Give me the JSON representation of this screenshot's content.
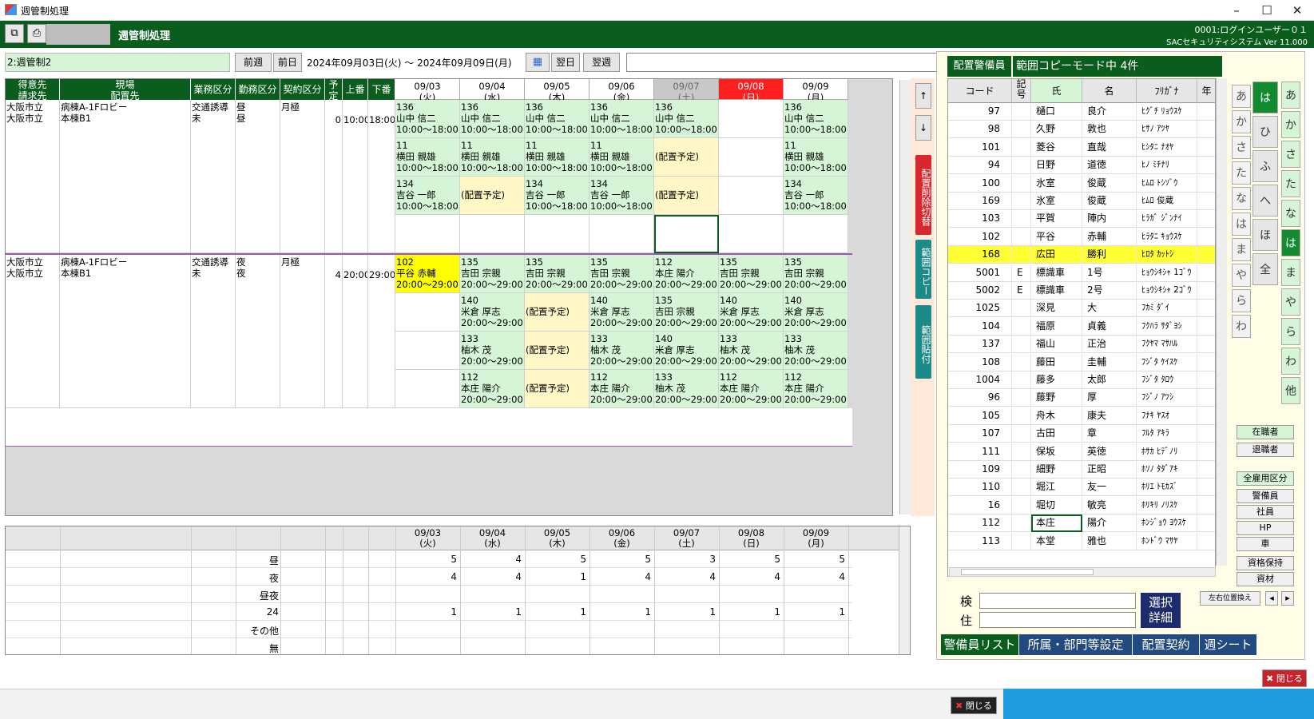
{
  "window": {
    "title": "週管制処理",
    "min": "–",
    "max": "☐",
    "close": "✕"
  },
  "app": {
    "name": "週管制処理",
    "user": "0001:ログインユーザー０１",
    "version": "SACセキュリティシステム Ver 11.000"
  },
  "toolbar": {
    "mode": "2:週管制2",
    "prev_week": "前週",
    "prev_day": "前日",
    "range": "2024年09月03日(火) ～ 2024年09月09日(月)",
    "next_day": "翌日",
    "next_week": "翌週"
  },
  "grid": {
    "headers": [
      "得意先\n請求先",
      "現場\n配置先",
      "業務区分",
      "勤務区分",
      "契約区分",
      "予\n定",
      "上番",
      "下番"
    ],
    "days": [
      {
        "d": "09/03",
        "w": "(火)"
      },
      {
        "d": "09/04",
        "w": "(水)"
      },
      {
        "d": "09/05",
        "w": "(木)"
      },
      {
        "d": "09/06",
        "w": "(金)"
      },
      {
        "d": "09/07",
        "w": "(土)"
      },
      {
        "d": "09/08",
        "w": "(日)"
      },
      {
        "d": "09/09",
        "w": "(月)"
      }
    ],
    "group1": {
      "cust1": "大阪市立",
      "cust2": "大阪市立",
      "site1": "病棟A-1Fロビー",
      "site2": "本棟B1",
      "work1": "交通誘導",
      "work2": "未",
      "shift1": "昼",
      "shift2": "昼",
      "contract": "月極",
      "plan": "0",
      "start": "10:00",
      "end": "18:00"
    },
    "group2": {
      "cust1": "大阪市立",
      "cust2": "大阪市立",
      "site1": "病棟A-1Fロビー",
      "site2": "本棟B1",
      "work1": "交通誘導",
      "work2": "未",
      "shift1": "夜",
      "shift2": "夜",
      "contract": "月極",
      "plan": "4",
      "start": "20:00",
      "end": "29:00"
    },
    "rows1": [
      [
        {
          "c": "g",
          "t": "136\n山中 信二\n10:00～18:00"
        },
        {
          "c": "g",
          "t": "136\n山中 信二\n10:00～18:00"
        },
        {
          "c": "g",
          "t": "136\n山中 信二\n10:00～18:00"
        },
        {
          "c": "g",
          "t": "136\n山中 信二\n10:00～18:00"
        },
        {
          "c": "g",
          "t": "136\n山中 信二\n10:00～18:00"
        },
        {
          "c": "w",
          "t": ""
        },
        {
          "c": "g",
          "t": "136\n山中 信二\n10:00～18:00"
        }
      ],
      [
        {
          "c": "g",
          "t": "11\n横田 親雄\n10:00～18:00"
        },
        {
          "c": "g",
          "t": "11\n横田 親雄\n10:00～18:00"
        },
        {
          "c": "g",
          "t": "11\n横田 親雄\n10:00～18:00"
        },
        {
          "c": "g",
          "t": "11\n横田 親雄\n10:00～18:00"
        },
        {
          "c": "y",
          "t": "\n(配置予定)"
        },
        {
          "c": "w",
          "t": ""
        },
        {
          "c": "g",
          "t": "11\n横田 親雄\n10:00～18:00"
        }
      ],
      [
        {
          "c": "g",
          "t": "134\n吉谷 一郎\n10:00～18:00"
        },
        {
          "c": "y",
          "t": "\n(配置予定)"
        },
        {
          "c": "g",
          "t": "134\n吉谷 一郎\n10:00～18:00"
        },
        {
          "c": "g",
          "t": "134\n吉谷 一郎\n10:00～18:00"
        },
        {
          "c": "y",
          "t": "\n(配置予定)"
        },
        {
          "c": "w",
          "t": ""
        },
        {
          "c": "g",
          "t": "134\n吉谷 一郎\n10:00～18:00"
        }
      ],
      [
        {
          "c": "w",
          "t": ""
        },
        {
          "c": "w",
          "t": ""
        },
        {
          "c": "w",
          "t": ""
        },
        {
          "c": "w",
          "t": ""
        },
        {
          "c": "w",
          "t": ""
        },
        {
          "c": "w",
          "t": ""
        },
        {
          "c": "w",
          "t": ""
        }
      ]
    ],
    "rows2": [
      [
        {
          "c": "yy",
          "t": "102\n平谷 赤輔\n20:00～29:00"
        },
        {
          "c": "g",
          "t": "135\n吉田 宗親\n20:00～29:00"
        },
        {
          "c": "g",
          "t": "135\n吉田 宗親\n20:00～29:00"
        },
        {
          "c": "g",
          "t": "135\n吉田 宗親\n20:00～29:00"
        },
        {
          "c": "g",
          "t": "112\n本庄 陽介\n20:00～29:00"
        },
        {
          "c": "g",
          "t": "135\n吉田 宗親\n20:00～29:00"
        },
        {
          "c": "g",
          "t": "135\n吉田 宗親\n20:00～29:00"
        }
      ],
      [
        {
          "c": "w",
          "t": ""
        },
        {
          "c": "g",
          "t": "140\n米倉 厚志\n20:00～29:00"
        },
        {
          "c": "y",
          "t": "\n(配置予定)"
        },
        {
          "c": "g",
          "t": "140\n米倉 厚志\n20:00～29:00"
        },
        {
          "c": "g",
          "t": "135\n吉田 宗親\n20:00～29:00"
        },
        {
          "c": "g",
          "t": "140\n米倉 厚志\n20:00～29:00"
        },
        {
          "c": "g",
          "t": "140\n米倉 厚志\n20:00～29:00"
        }
      ],
      [
        {
          "c": "w",
          "t": ""
        },
        {
          "c": "g",
          "t": "133\n柚木 茂\n20:00～29:00"
        },
        {
          "c": "y",
          "t": "\n(配置予定)"
        },
        {
          "c": "g",
          "t": "133\n柚木 茂\n20:00～29:00"
        },
        {
          "c": "g",
          "t": "140\n米倉 厚志\n20:00～29:00"
        },
        {
          "c": "g",
          "t": "133\n柚木 茂\n20:00～29:00"
        },
        {
          "c": "g",
          "t": "133\n柚木 茂\n20:00～29:00"
        }
      ],
      [
        {
          "c": "w",
          "t": ""
        },
        {
          "c": "g",
          "t": "112\n本庄 陽介\n20:00～29:00"
        },
        {
          "c": "y",
          "t": "\n(配置予定)"
        },
        {
          "c": "g",
          "t": "112\n本庄 陽介\n20:00～29:00"
        },
        {
          "c": "g",
          "t": "133\n柚木 茂\n20:00～29:00"
        },
        {
          "c": "g",
          "t": "112\n本庄 陽介\n20:00～29:00"
        },
        {
          "c": "g",
          "t": "112\n本庄 陽介\n20:00～29:00"
        }
      ]
    ]
  },
  "side_buttons": {
    "up": "↑",
    "down": "↓",
    "delete": "配置削除切替",
    "copy": "範囲コピー",
    "paste": "範囲貼付"
  },
  "summary": {
    "rows": [
      {
        "label": "昼",
        "v": [
          "5",
          "4",
          "5",
          "5",
          "3",
          "5",
          "5"
        ]
      },
      {
        "label": "夜",
        "v": [
          "4",
          "4",
          "1",
          "4",
          "4",
          "4",
          "4"
        ]
      },
      {
        "label": "昼夜",
        "v": [
          "",
          "",
          "",
          "",
          "",
          "",
          ""
        ]
      },
      {
        "label": "24",
        "v": [
          "1",
          "1",
          "1",
          "1",
          "1",
          "1",
          "1"
        ]
      },
      {
        "label": "その他",
        "v": [
          "",
          "",
          "",
          "",
          "",
          "",
          ""
        ]
      },
      {
        "label": "無",
        "v": [
          "",
          "",
          "",
          "",
          "",
          "",
          ""
        ]
      }
    ]
  },
  "right": {
    "title": "配置警備員",
    "mode": "範囲コピーモード中 4件",
    "cols": [
      "コード",
      "記\n号",
      "氏",
      "名",
      "ﾌﾘｶﾞﾅ",
      "年"
    ],
    "staff": [
      [
        "97",
        "",
        "樋口",
        "良介",
        "ﾋｸﾞﾁ ﾘｮｳｽｹ"
      ],
      [
        "98",
        "",
        "久野",
        "敦也",
        "ﾋｻﾉ ｱﾂﾔ"
      ],
      [
        "101",
        "",
        "菱谷",
        "直哉",
        "ﾋｼﾀﾆ ﾅｵﾔ"
      ],
      [
        "94",
        "",
        "日野",
        "道徳",
        "ﾋﾉ ﾐﾁﾅﾘ"
      ],
      [
        "100",
        "",
        "氷室",
        "俊蔵",
        "ﾋﾑﾛ ﾄｼｿﾞｳ"
      ],
      [
        "169",
        "",
        "氷室",
        "俊蔵",
        "ﾋﾑﾛ 俊蔵"
      ],
      [
        "103",
        "",
        "平賀",
        "陣内",
        "ﾋﾗｶﾞ ｼﾞﾝﾅｲ"
      ],
      [
        "102",
        "",
        "平谷",
        "赤輔",
        "ﾋﾗﾀﾆ ｷｮｳｽｹ"
      ],
      [
        "168",
        "",
        "広田",
        "勝利",
        "ﾋﾛﾀ ｶｯﾄｼ"
      ],
      [
        "5001",
        "E",
        "標識車",
        "1号",
        "ﾋｮｳｼｷｼｬ 1ｺﾞｳ"
      ],
      [
        "5002",
        "E",
        "標識車",
        "2号",
        "ﾋｮｳｼｷｼｬ 2ｺﾞｳ"
      ],
      [
        "1025",
        "",
        "深見",
        "大",
        "ﾌｶﾐ ﾀﾞｲ"
      ],
      [
        "104",
        "",
        "福原",
        "貞義",
        "ﾌｸﾊﾗ ｻﾀﾞﾖｼ"
      ],
      [
        "137",
        "",
        "福山",
        "正治",
        "ﾌｸﾔﾏ ﾏｻﾊﾙ"
      ],
      [
        "108",
        "",
        "藤田",
        "圭輔",
        "ﾌｼﾞﾀ ｹｲｽｹ"
      ],
      [
        "1004",
        "",
        "藤多",
        "太郎",
        "ﾌｼﾞﾀ ﾀﾛｳ"
      ],
      [
        "96",
        "",
        "藤野",
        "厚",
        "ﾌｼﾞﾉ ｱﾂｼ"
      ],
      [
        "105",
        "",
        "舟木",
        "康夫",
        "ﾌﾅｷ ﾔｽｵ"
      ],
      [
        "107",
        "",
        "古田",
        "章",
        "ﾌﾙﾀ ｱｷﾗ"
      ],
      [
        "111",
        "",
        "保坂",
        "英徳",
        "ﾎｻｶ ﾋﾃﾞﾉﾘ"
      ],
      [
        "109",
        "",
        "細野",
        "正昭",
        "ﾎｿﾉ ﾀﾀﾞｱｷ"
      ],
      [
        "110",
        "",
        "堀江",
        "友一",
        "ﾎﾘｴ ﾄﾓｶｽﾞ"
      ],
      [
        "16",
        "",
        "堀切",
        "敏亮",
        "ﾎﾘｷﾘ ﾉﾘｽｹ"
      ],
      [
        "112",
        "",
        "本庄",
        "陽介",
        "ﾎﾝｼﾞｮｳ ﾖｳｽｹ"
      ],
      [
        "113",
        "",
        "本堂",
        "雅也",
        "ﾎﾝﾄﾞｳ ﾏｻﾔ"
      ]
    ],
    "kana_small": [
      "あ",
      "か",
      "さ",
      "た",
      "な",
      "は",
      "ま",
      "や",
      "ら",
      "わ"
    ],
    "kana_mid": [
      "は",
      "ひ",
      "ふ",
      "へ",
      "ほ",
      "全"
    ],
    "kana_right": [
      "あ",
      "か",
      "さ",
      "た",
      "な",
      "は",
      "ま",
      "や",
      "ら",
      "わ",
      "他"
    ],
    "btns": {
      "active": "在職者",
      "retired": "退職者",
      "all": "全雇用区分",
      "guard": "警備員",
      "staff": "社員",
      "hp": "HP",
      "car": "車",
      "qual": "資格保持",
      "mat": "資材",
      "swap": "左右位置換え"
    },
    "search_label": "検",
    "addr_label": "住",
    "select": "選択\n詳細",
    "tabs": [
      "警備員リスト",
      "所属・部門等設定",
      "配置契約",
      "週シート"
    ],
    "close": "閉じる"
  },
  "footer": {
    "close": "閉じる"
  }
}
